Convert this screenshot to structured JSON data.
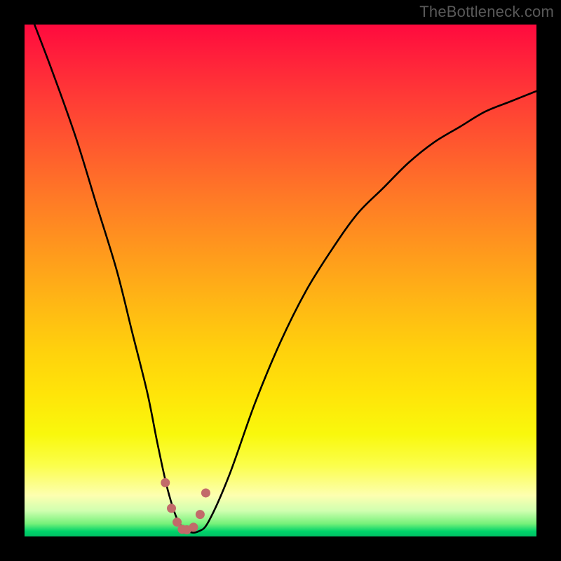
{
  "watermark": "TheBottleneck.com",
  "chart_data": {
    "type": "line",
    "title": "",
    "xlabel": "",
    "ylabel": "",
    "xlim": [
      0,
      100
    ],
    "ylim": [
      0,
      100
    ],
    "grid": false,
    "legend": false,
    "background_gradient": {
      "stops": [
        {
          "pct": 0,
          "color": "#ff0a3e"
        },
        {
          "pct": 50,
          "color": "#ffb615"
        },
        {
          "pct": 80,
          "color": "#f9f80c"
        },
        {
          "pct": 100,
          "color": "#00c064"
        }
      ]
    },
    "series": [
      {
        "name": "bottleneck-curve",
        "x": [
          0,
          5,
          10,
          14,
          18,
          21,
          24,
          26,
          28,
          30,
          32,
          34,
          36,
          40,
          45,
          50,
          55,
          60,
          65,
          70,
          75,
          80,
          85,
          90,
          95,
          100
        ],
        "y": [
          105,
          92,
          78,
          65,
          52,
          40,
          28,
          18,
          9,
          3,
          1,
          1,
          3,
          12,
          26,
          38,
          48,
          56,
          63,
          68,
          73,
          77,
          80,
          83,
          85,
          87
        ]
      }
    ],
    "markers": {
      "name": "optimum-markers",
      "x": [
        27.5,
        28.7,
        29.8,
        30.8,
        31.7,
        33.0,
        34.3,
        35.4
      ],
      "y": [
        10.5,
        5.5,
        2.8,
        1.4,
        1.3,
        1.8,
        4.3,
        8.5
      ],
      "color": "#c26a6a",
      "size": 6
    }
  }
}
